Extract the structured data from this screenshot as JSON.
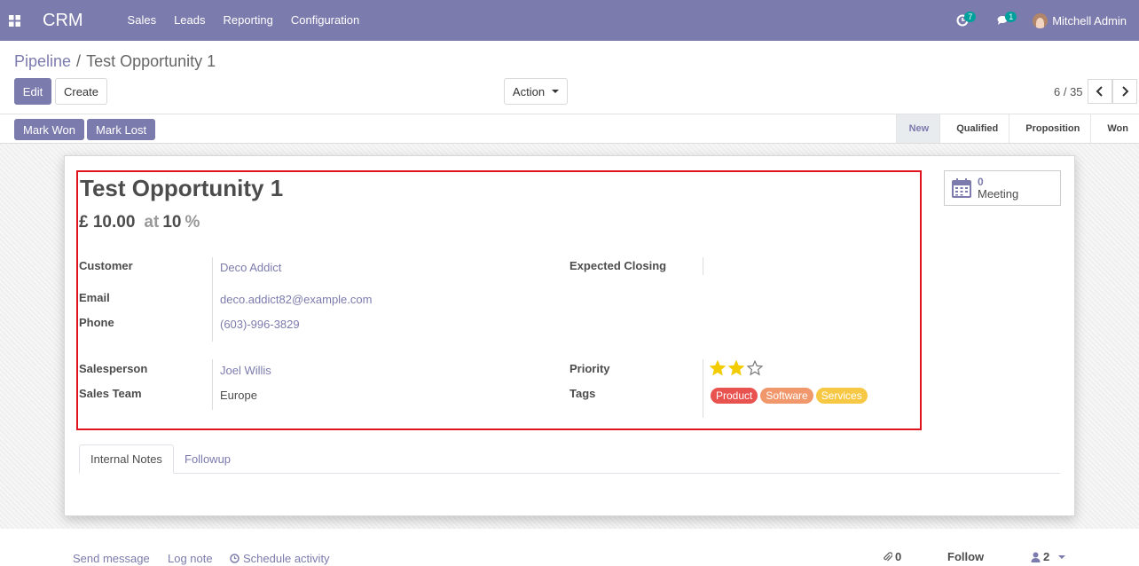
{
  "navbar": {
    "brand": "CRM",
    "menu": [
      "Sales",
      "Leads",
      "Reporting",
      "Configuration"
    ],
    "activity_count": "7",
    "message_count": "1",
    "user_name": "Mitchell Admin"
  },
  "control": {
    "breadcrumb_parent": "Pipeline",
    "breadcrumb_sep": "/",
    "breadcrumb_current": "Test Opportunity 1",
    "edit_label": "Edit",
    "create_label": "Create",
    "action_label": "Action",
    "pager": "6 / 35"
  },
  "statusbar": {
    "mark_won": "Mark Won",
    "mark_lost": "Mark Lost",
    "stages": [
      "New",
      "Qualified",
      "Proposition",
      "Won"
    ],
    "active_stage": "New"
  },
  "form": {
    "title": "Test Opportunity 1",
    "revenue": "£ 10.00",
    "at_label": "at",
    "probability": "10",
    "pct_sign": "%",
    "customer_label": "Customer",
    "customer": "Deco Addict",
    "email_label": "Email",
    "email": "deco.addict82@example.com",
    "phone_label": "Phone",
    "phone": "(603)-996-3829",
    "salesperson_label": "Salesperson",
    "salesperson": "Joel Willis",
    "team_label": "Sales Team",
    "team": "Europe",
    "closing_label": "Expected Closing",
    "priority_label": "Priority",
    "priority_level": 2,
    "priority_max": 3,
    "tags_label": "Tags",
    "tags": [
      {
        "label": "Product",
        "color": "#e8524f"
      },
      {
        "label": "Software",
        "color": "#f0976b"
      },
      {
        "label": "Services",
        "color": "#f7c843"
      }
    ],
    "meeting_count": "0",
    "meeting_label": "Meeting"
  },
  "tabs": [
    "Internal Notes",
    "Followup"
  ],
  "chatter": {
    "send_message": "Send message",
    "log_note": "Log note",
    "schedule_activity": "Schedule activity",
    "attachments": "0",
    "follow": "Follow",
    "followers": "2"
  },
  "colors": {
    "brand": "#7c7bad",
    "star": "#f3cc00",
    "highlight": "#e0141e"
  }
}
